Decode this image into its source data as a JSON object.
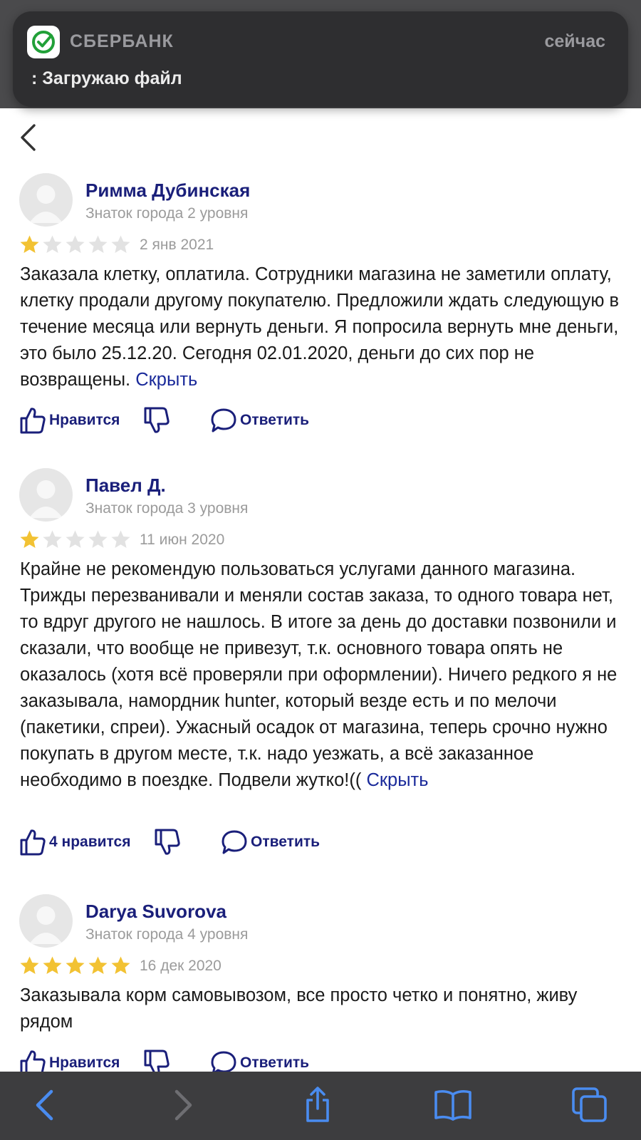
{
  "notification": {
    "app_name": "СБЕРБАНК",
    "time": "сейчас",
    "message": ": Загружаю файл",
    "icon": "sberbank-logo-icon"
  },
  "nav": {
    "back_icon": "chevron-left-icon"
  },
  "colors": {
    "author": "#1a1f7a",
    "link": "#1a2a9a",
    "star_filled": "#f2c233",
    "star_empty": "#e2e2e2"
  },
  "reviews": [
    {
      "author": "Римма Дубинская",
      "badge": "Знаток города 2 уровня",
      "rating": 1,
      "date": "2 янв 2021",
      "text": "Заказала клетку, оплатила. Сотрудники магазина не заметили оплату, клетку продали другому покупателю. Предложили ждать следующую в течение месяца или вернуть деньги. Я попросила вернуть мне деньги, это было 25.12.20. Сегодня 02.01.2020, деньги до сих пор не возвращены.",
      "hide_label": "Скрыть",
      "like_label": "Нравится",
      "reply_label": "Ответить"
    },
    {
      "author": "Павел Д.",
      "badge": "Знаток города 3 уровня",
      "rating": 1,
      "date": "11 июн 2020",
      "text": "Крайне не рекомендую пользоваться услугами данного магазина. Трижды перезванивали и меняли состав заказа, то одного товара нет, то вдруг другого не нашлось. В итоге за день до доставки позвонили и сказали, что вообще не привезут, т.к. основного товара опять не оказалось (хотя всё проверяли при оформлении). Ничего редкого я не заказывала, намордник hunter, который везде есть и по мелочи (пакетики, спреи). Ужасный осадок от магазина, теперь срочно нужно покупать в другом месте, т.к. надо уезжать, а всё заказанное необходимо в поездке. Подвели жутко!((",
      "hide_label": "Скрыть",
      "like_label": "4 нравится",
      "reply_label": "Ответить"
    },
    {
      "author": "Darya Suvorova",
      "badge": "Знаток города 4 уровня",
      "rating": 5,
      "date": "16 дек 2020",
      "text": "Заказывала корм самовывозом, все просто четко и понятно, живу рядом",
      "like_label": "Нравится",
      "reply_label": "Ответить"
    }
  ],
  "bottom_bar": {
    "icons": [
      "back-arrow-icon",
      "forward-arrow-icon",
      "share-icon",
      "bookmarks-icon",
      "tabs-icon"
    ]
  }
}
